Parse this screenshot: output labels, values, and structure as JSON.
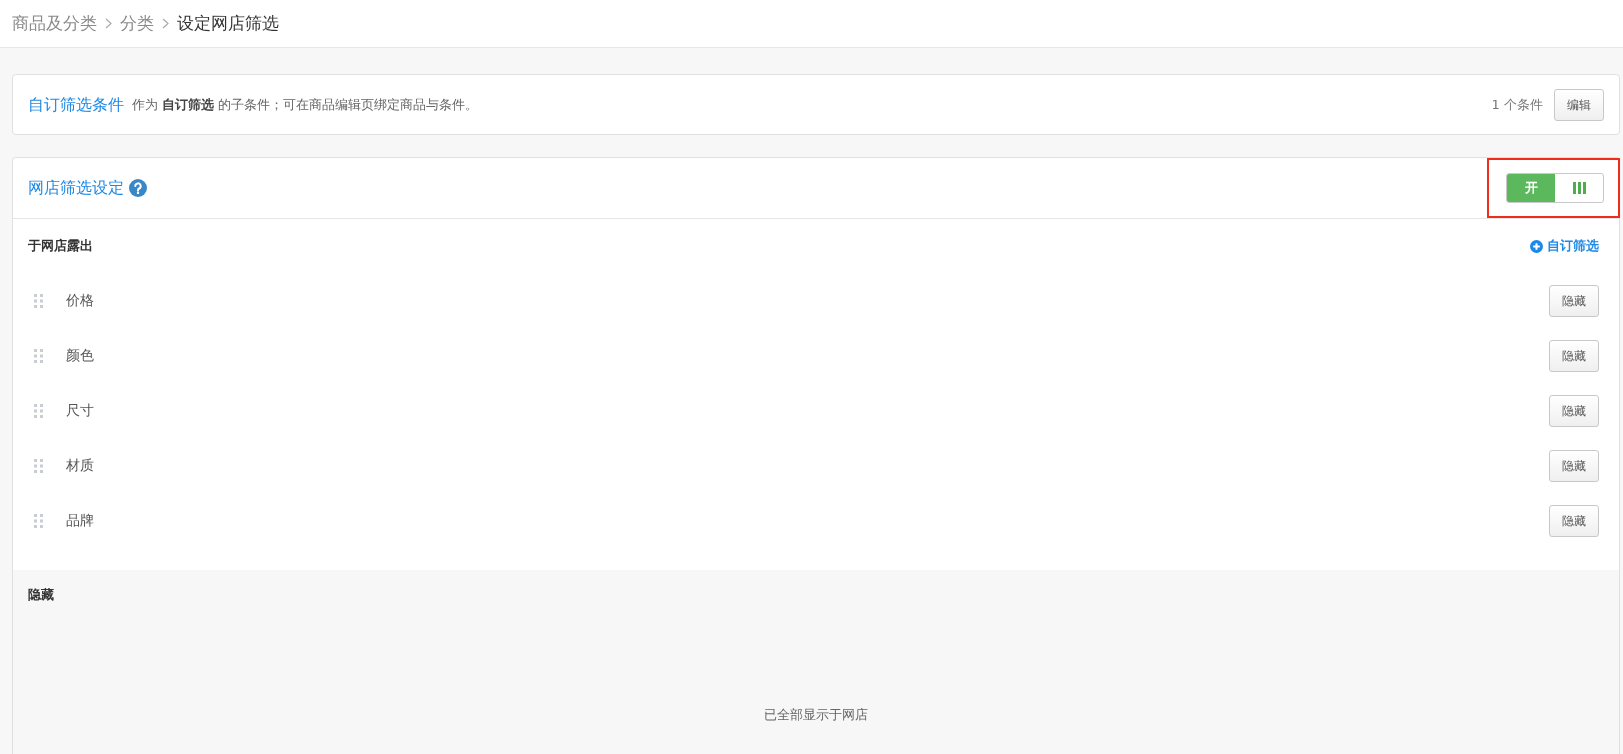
{
  "breadcrumb": [
    {
      "label": "商品及分类",
      "current": false
    },
    {
      "label": "分类",
      "current": false
    },
    {
      "label": "设定网店筛选",
      "current": true
    }
  ],
  "custom_filter_card": {
    "title": "自订筛选条件",
    "description": "作为 **自订筛选** 的子条件；可在商品编辑页绑定商品与条件。",
    "count": "1 个条件",
    "button": "编辑"
  },
  "shop_filter_panel": {
    "title": "网店筛选设定",
    "toggle": {
      "label": "开",
      "on": true,
      "highlighted": true
    },
    "shown_section": {
      "heading": "于网店露出",
      "add_link": "自订筛选",
      "items": [
        {
          "name": "价格",
          "button": "隐藏"
        },
        {
          "name": "颜色",
          "button": "隐藏"
        },
        {
          "name": "尺寸",
          "button": "隐藏"
        },
        {
          "name": "材质",
          "button": "隐藏"
        },
        {
          "name": "品牌",
          "button": "隐藏"
        }
      ]
    },
    "hidden_section": {
      "heading": "隐藏",
      "empty_message": "已全部显示于网店"
    }
  }
}
